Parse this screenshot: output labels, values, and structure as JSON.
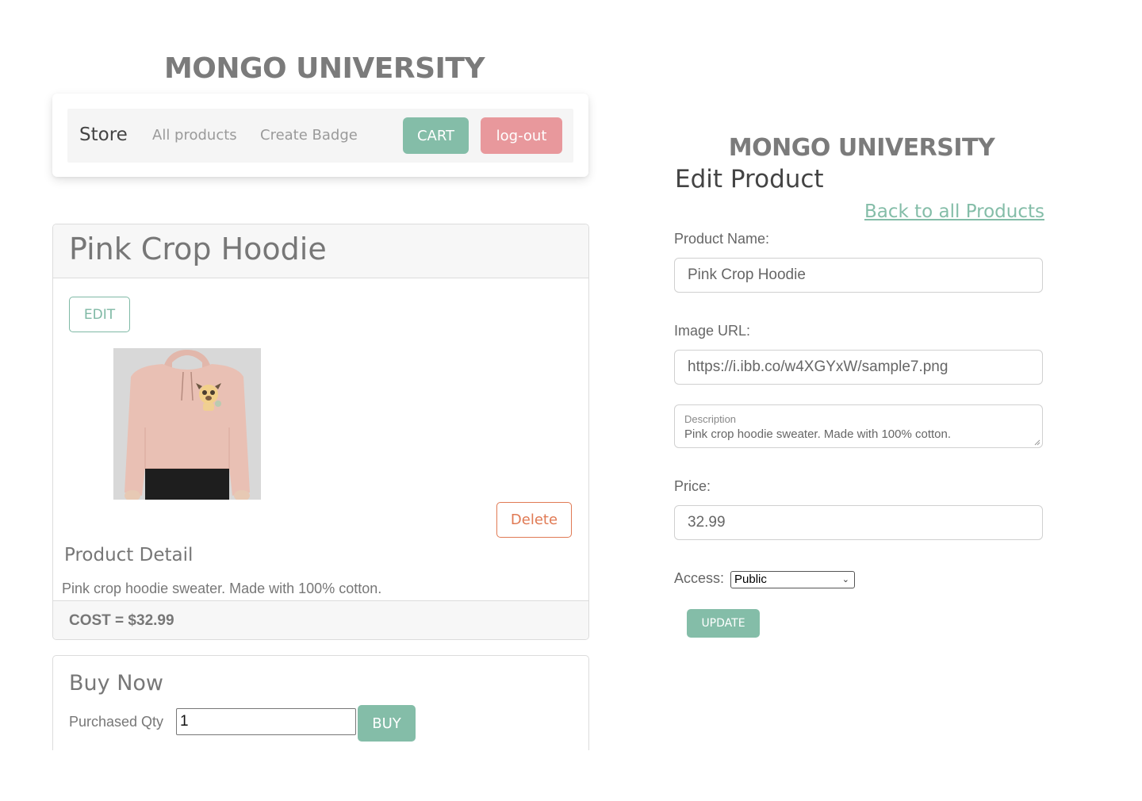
{
  "left": {
    "brand": "MONGO UNIVERSITY",
    "nav": {
      "brand": "Store",
      "links": [
        "All products",
        "Create Badge"
      ],
      "cart_label": "CART",
      "logout_label": "log-out"
    },
    "product": {
      "title": "Pink Crop Hoodie",
      "edit_label": "EDIT",
      "delete_label": "Delete",
      "detail_heading": "Product Detail",
      "description": "Pink crop hoodie sweater. Made with 100% cotton.",
      "cost": "COST = $32.99"
    },
    "buy": {
      "title": "Buy Now",
      "qty_label": "Purchased Qty",
      "qty_value": "1",
      "buy_label": "BUY"
    }
  },
  "right": {
    "brand": "MONGO UNIVERSITY",
    "title": "Edit Product",
    "back_link": "Back to all Products",
    "name_label": "Product Name:",
    "name_value": "Pink Crop Hoodie",
    "image_label": "Image URL:",
    "image_value": "https://i.ibb.co/w4XGYxW/sample7.png",
    "description_label": "Description",
    "description_value": "Pink crop hoodie sweater. Made with 100% cotton.",
    "price_label": "Price:",
    "price_value": "32.99",
    "access_label": "Access:",
    "access_value": "Public",
    "update_label": "UPDATE"
  },
  "colors": {
    "accent_green": "#84bda8",
    "logout_pink": "#e8989c",
    "delete_orange": "#e07a54"
  }
}
